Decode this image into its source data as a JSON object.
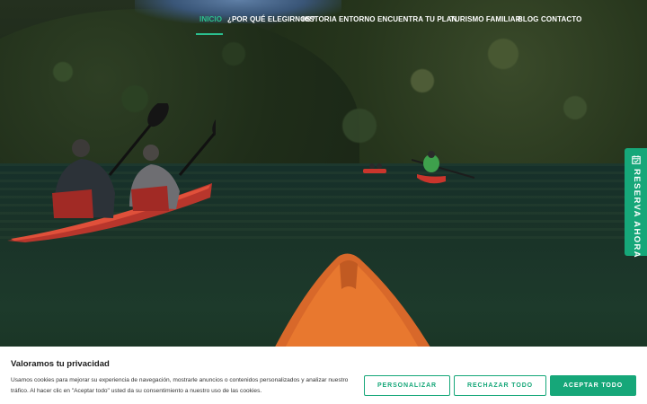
{
  "nav": {
    "items": [
      {
        "label": "INICIO",
        "active": true
      },
      {
        "label": "¿POR QUÉ ELEGIRNOS?",
        "active": false
      },
      {
        "label": "HISTORIA",
        "active": false
      },
      {
        "label": "ENTORNO",
        "active": false
      },
      {
        "label": "ENCUENTRA TU PLAN",
        "active": false
      },
      {
        "label": "TURISMO FAMILIAR",
        "active": false
      },
      {
        "label": "BLOG",
        "active": false
      },
      {
        "label": "CONTACTO",
        "active": false
      }
    ]
  },
  "side_tab": {
    "label": "RESERVA AHORA",
    "icon": "calendar-icon"
  },
  "cookie_banner": {
    "title": "Valoramos tu privacidad",
    "text": "Usamos cookies para mejorar su experiencia de navegación, mostrarle anuncios o contenidos personalizados y analizar nuestro tráfico. Al hacer clic en \"Aceptar todo\" usted da su consentimiento a nuestro uso de las cookies.",
    "buttons": {
      "customize": "PERSONALIZAR",
      "reject": "RECHAZAR TODO",
      "accept": "ACEPTAR TODO"
    }
  },
  "colors": {
    "accent": "#16a779",
    "nav_active": "#2bc08f",
    "kayak_orange": "#e8782f",
    "kayak_red": "#c9352c"
  }
}
